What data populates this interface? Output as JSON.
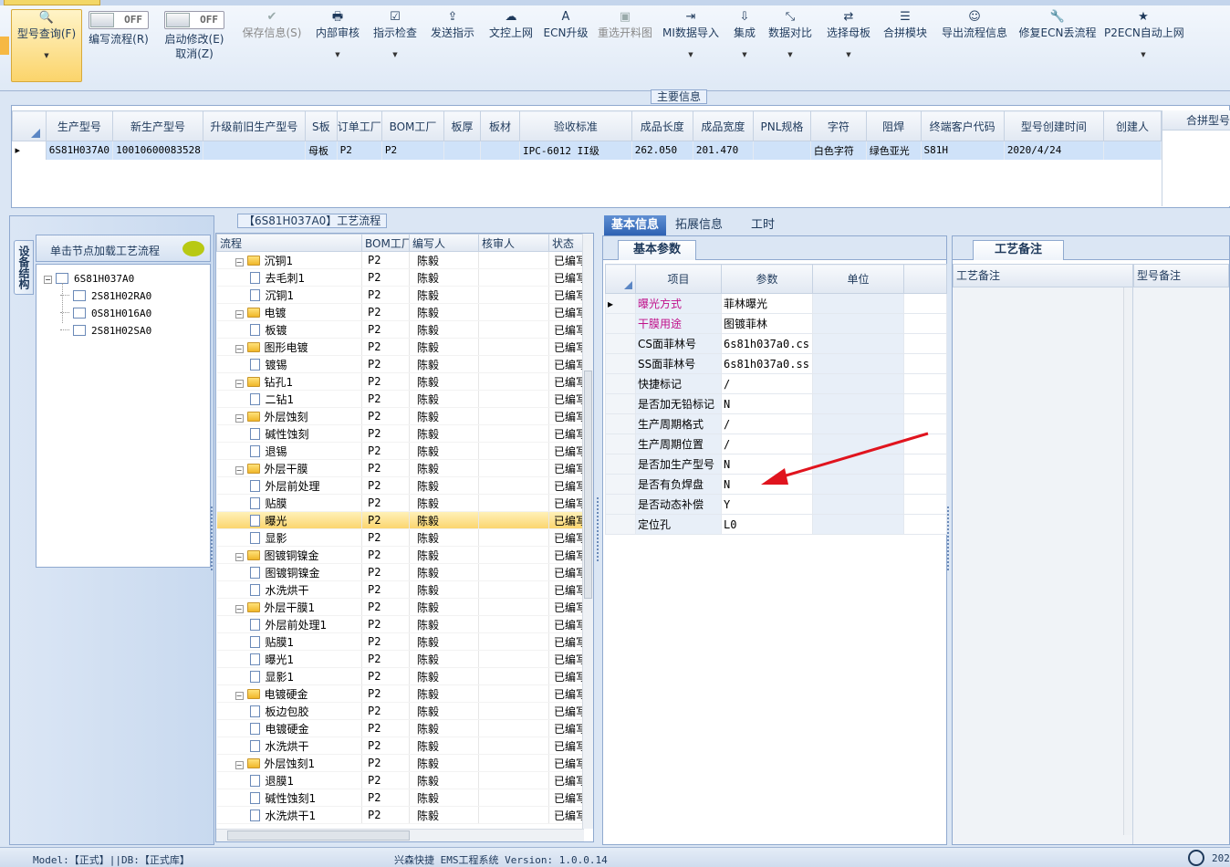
{
  "ribbon": {
    "buttons": [
      {
        "label": "型号查询(F)",
        "icon": "search-icon",
        "state": "selected",
        "dropdown": true
      },
      {
        "label": "编写流程(R)",
        "icon": "toggle-off",
        "toggle": "OFF"
      },
      {
        "label": "启动修改(E)",
        "label2": "取消(Z)",
        "icon": "toggle-off",
        "toggle": "OFF"
      },
      {
        "label": "保存信息(S)",
        "icon": "check-icon",
        "state": "disabled"
      },
      {
        "label": "内部审核",
        "icon": "printer-icon",
        "dropdown": true
      },
      {
        "label": "指示检查",
        "icon": "checkbox-icon",
        "dropdown": true
      },
      {
        "label": "发送指示",
        "icon": "upload-icon"
      },
      {
        "label": "文控上网",
        "icon": "cloud-upload-icon"
      },
      {
        "label": "ECN升级",
        "icon": "font-icon"
      },
      {
        "label": "重选开料图",
        "icon": "image-icon",
        "state": "disabled"
      },
      {
        "label": "MI数据导入",
        "icon": "sign-in-icon",
        "dropdown": true
      },
      {
        "label": "集成",
        "icon": "download-icon",
        "dropdown": true
      },
      {
        "label": "数据对比",
        "icon": "compress-icon",
        "dropdown": true
      },
      {
        "label": "选择母板",
        "icon": "shuffle-icon",
        "dropdown": true
      },
      {
        "label": "合拼模块",
        "icon": "list-icon"
      },
      {
        "label": "导出流程信息",
        "icon": "smile-icon"
      },
      {
        "label": "修复ECN丢流程",
        "icon": "wrench-icon"
      },
      {
        "label": "P2ECN自动上网",
        "icon": "star-icon",
        "dropdown": true
      }
    ]
  },
  "main_info": {
    "title": "主要信息",
    "columns": [
      "生产型号",
      "新生产型号",
      "升级前旧生产型号",
      "S板",
      "订单工厂",
      "BOM工厂",
      "板厚",
      "板材",
      "验收标准",
      "成品长度",
      "成品宽度",
      "PNL规格",
      "字符",
      "阻焊",
      "终端客户代码",
      "型号创建时间",
      "创建人"
    ],
    "row": [
      "6S81H037A0",
      "10010600083528",
      "",
      "母板",
      "P2",
      "P2",
      "",
      "",
      "IPC-6012 II级",
      "262.050",
      "201.470",
      "",
      "白色字符",
      "绿色亚光",
      "S81H",
      "2020/4/24",
      ""
    ],
    "side_panel_title": "合拼型号"
  },
  "left_panel": {
    "vertical_tab": "设备结构",
    "hint": "单击节点加载工艺流程",
    "tree": [
      {
        "label": "6S81H037A0",
        "level": 0
      },
      {
        "label": "2S81H02RA0",
        "level": 1
      },
      {
        "label": "0S81H016A0",
        "level": 1
      },
      {
        "label": "2S81H02SA0",
        "level": 1
      }
    ]
  },
  "process_flow": {
    "title": "【6S81H037A0】工艺流程",
    "columns": [
      "流程",
      "BOM工厂",
      "编写人",
      "核审人",
      "状态"
    ],
    "rows": [
      {
        "name": "沉铜1",
        "type": "folder",
        "bom": "P2",
        "writer": "陈毅",
        "status": "已编写"
      },
      {
        "name": "去毛刺1",
        "type": "page",
        "bom": "P2",
        "writer": "陈毅",
        "status": "已编写"
      },
      {
        "name": "沉铜1",
        "type": "page",
        "bom": "P2",
        "writer": "陈毅",
        "status": "已编写"
      },
      {
        "name": "电镀",
        "type": "folder",
        "bom": "P2",
        "writer": "陈毅",
        "status": "已编写"
      },
      {
        "name": "板镀",
        "type": "page",
        "bom": "P2",
        "writer": "陈毅",
        "status": "已编写"
      },
      {
        "name": "图形电镀",
        "type": "folder",
        "bom": "P2",
        "writer": "陈毅",
        "status": "已编写"
      },
      {
        "name": "镀锡",
        "type": "page",
        "bom": "P2",
        "writer": "陈毅",
        "status": "已编写"
      },
      {
        "name": "钻孔1",
        "type": "folder",
        "bom": "P2",
        "writer": "陈毅",
        "status": "已编写"
      },
      {
        "name": "二钻1",
        "type": "page",
        "bom": "P2",
        "writer": "陈毅",
        "status": "已编写"
      },
      {
        "name": "外层蚀刻",
        "type": "folder",
        "bom": "P2",
        "writer": "陈毅",
        "status": "已编写"
      },
      {
        "name": "碱性蚀刻",
        "type": "page",
        "bom": "P2",
        "writer": "陈毅",
        "status": "已编写"
      },
      {
        "name": "退锡",
        "type": "page",
        "bom": "P2",
        "writer": "陈毅",
        "status": "已编写"
      },
      {
        "name": "外层干膜",
        "type": "folder",
        "bom": "P2",
        "writer": "陈毅",
        "status": "已编写"
      },
      {
        "name": "外层前处理",
        "type": "page",
        "bom": "P2",
        "writer": "陈毅",
        "status": "已编写"
      },
      {
        "name": "贴膜",
        "type": "page",
        "bom": "P2",
        "writer": "陈毅",
        "status": "已编写"
      },
      {
        "name": "曝光",
        "type": "page",
        "bom": "P2",
        "writer": "陈毅",
        "status": "已编写",
        "selected": true
      },
      {
        "name": "显影",
        "type": "page",
        "bom": "P2",
        "writer": "陈毅",
        "status": "已编写"
      },
      {
        "name": "图镀铜镍金",
        "type": "folder",
        "bom": "P2",
        "writer": "陈毅",
        "status": "已编写"
      },
      {
        "name": "图镀铜镍金",
        "type": "page",
        "bom": "P2",
        "writer": "陈毅",
        "status": "已编写"
      },
      {
        "name": "水洗烘干",
        "type": "page",
        "bom": "P2",
        "writer": "陈毅",
        "status": "已编写"
      },
      {
        "name": "外层干膜1",
        "type": "folder",
        "bom": "P2",
        "writer": "陈毅",
        "status": "已编写"
      },
      {
        "name": "外层前处理1",
        "type": "page",
        "bom": "P2",
        "writer": "陈毅",
        "status": "已编写"
      },
      {
        "name": "贴膜1",
        "type": "page",
        "bom": "P2",
        "writer": "陈毅",
        "status": "已编写"
      },
      {
        "name": "曝光1",
        "type": "page",
        "bom": "P2",
        "writer": "陈毅",
        "status": "已编写"
      },
      {
        "name": "显影1",
        "type": "page",
        "bom": "P2",
        "writer": "陈毅",
        "status": "已编写"
      },
      {
        "name": "电镀硬金",
        "type": "folder",
        "bom": "P2",
        "writer": "陈毅",
        "status": "已编写"
      },
      {
        "name": "板边包胶",
        "type": "page",
        "bom": "P2",
        "writer": "陈毅",
        "status": "已编写"
      },
      {
        "name": "电镀硬金",
        "type": "page",
        "bom": "P2",
        "writer": "陈毅",
        "status": "已编写"
      },
      {
        "name": "水洗烘干",
        "type": "page",
        "bom": "P2",
        "writer": "陈毅",
        "status": "已编写"
      },
      {
        "name": "外层蚀刻1",
        "type": "folder",
        "bom": "P2",
        "writer": "陈毅",
        "status": "已编写"
      },
      {
        "name": "退膜1",
        "type": "page",
        "bom": "P2",
        "writer": "陈毅",
        "status": "已编写"
      },
      {
        "name": "碱性蚀刻1",
        "type": "page",
        "bom": "P2",
        "writer": "陈毅",
        "status": "已编写"
      },
      {
        "name": "水洗烘干1",
        "type": "page",
        "bom": "P2",
        "writer": "陈毅",
        "status": "已编写"
      }
    ]
  },
  "detail": {
    "tabs": [
      "基本信息",
      "拓展信息",
      "工时"
    ],
    "sub_tab": "基本参数",
    "columns": [
      "项目",
      "参数",
      "单位"
    ],
    "rows": [
      {
        "item": "曝光方式",
        "value": "菲林曝光",
        "highlight": true
      },
      {
        "item": "干膜用途",
        "value": "图镀菲林",
        "highlight": true
      },
      {
        "item": "CS面菲林号",
        "value": "6s81h037a0.cs"
      },
      {
        "item": "SS面菲林号",
        "value": "6s81h037a0.ss"
      },
      {
        "item": "快捷标记",
        "value": "/"
      },
      {
        "item": "是否加无铅标记",
        "value": "N"
      },
      {
        "item": "生产周期格式",
        "value": "/"
      },
      {
        "item": "生产周期位置",
        "value": "/"
      },
      {
        "item": "是否加生产型号",
        "value": "N"
      },
      {
        "item": "是否有负焊盘",
        "value": "N"
      },
      {
        "item": "是否动态补偿",
        "value": "Y"
      },
      {
        "item": "定位孔",
        "value": "L0"
      }
    ]
  },
  "remarks": {
    "tab": "工艺备注",
    "col1": "工艺备注",
    "col2": "型号备注"
  },
  "status_bar": {
    "left": "Model:【正式】||DB:【正式库】",
    "center": "兴森快捷 EMS工程系统 Version: 1.0.0.14",
    "right": "202"
  },
  "colors": {
    "highlight_text": "#c0108a",
    "selection": "#fbd46b",
    "annotation_arrow": "#e0141e"
  }
}
